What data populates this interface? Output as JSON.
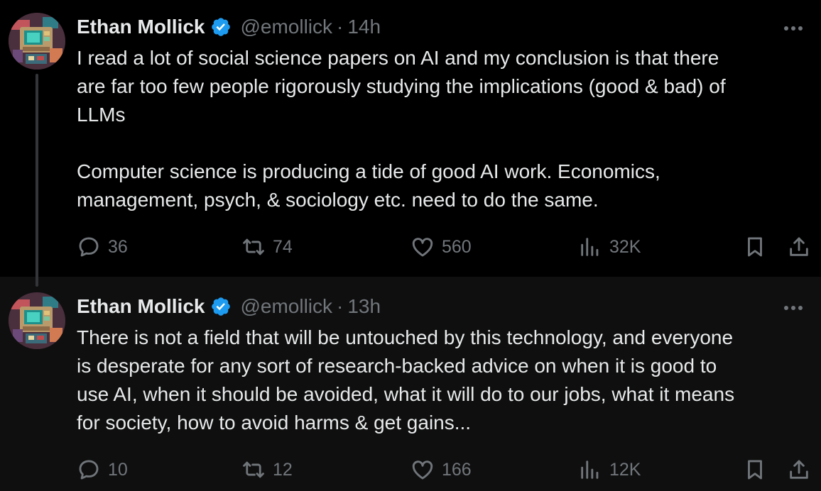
{
  "colors": {
    "background": "#000000",
    "background_secondary": "#0f0f0f",
    "text_primary": "#e7e9ea",
    "text_secondary": "#71767b",
    "verified_blue": "#1d9bf0",
    "thread_line": "#333639"
  },
  "tweets": [
    {
      "author": {
        "name": "Ethan Mollick",
        "handle": "@emollick",
        "verified": true,
        "avatar_icon": "pixel-art-device-avatar"
      },
      "separator": "·",
      "time": "14h",
      "text": "I read a lot of social science papers on AI and my conclusion is that there\nare far too few people rigorously studying the implications (good & bad) of\nLLMs\n\nComputer science is producing a tide of good AI work. Economics,\nmanagement, psych, & sociology etc. need to do the same.",
      "stats": {
        "replies": "36",
        "retweets": "74",
        "likes": "560",
        "views": "32K"
      },
      "icons": {
        "reply": "reply-icon",
        "retweet": "retweet-icon",
        "like": "heart-icon",
        "views": "views-icon",
        "bookmark": "bookmark-icon",
        "share": "share-icon",
        "more": "more-icon"
      }
    },
    {
      "author": {
        "name": "Ethan Mollick",
        "handle": "@emollick",
        "verified": true,
        "avatar_icon": "pixel-art-device-avatar"
      },
      "separator": "·",
      "time": "13h",
      "text": "There is not a field that will be untouched by this technology, and everyone\nis desperate for any sort of research-backed advice on when it is good to\nuse AI, when it should be avoided, what it will do to our jobs, what it means\nfor society, how to avoid harms & get gains...",
      "stats": {
        "replies": "10",
        "retweets": "12",
        "likes": "166",
        "views": "12K"
      },
      "icons": {
        "reply": "reply-icon",
        "retweet": "retweet-icon",
        "like": "heart-icon",
        "views": "views-icon",
        "bookmark": "bookmark-icon",
        "share": "share-icon",
        "more": "more-icon"
      }
    }
  ]
}
